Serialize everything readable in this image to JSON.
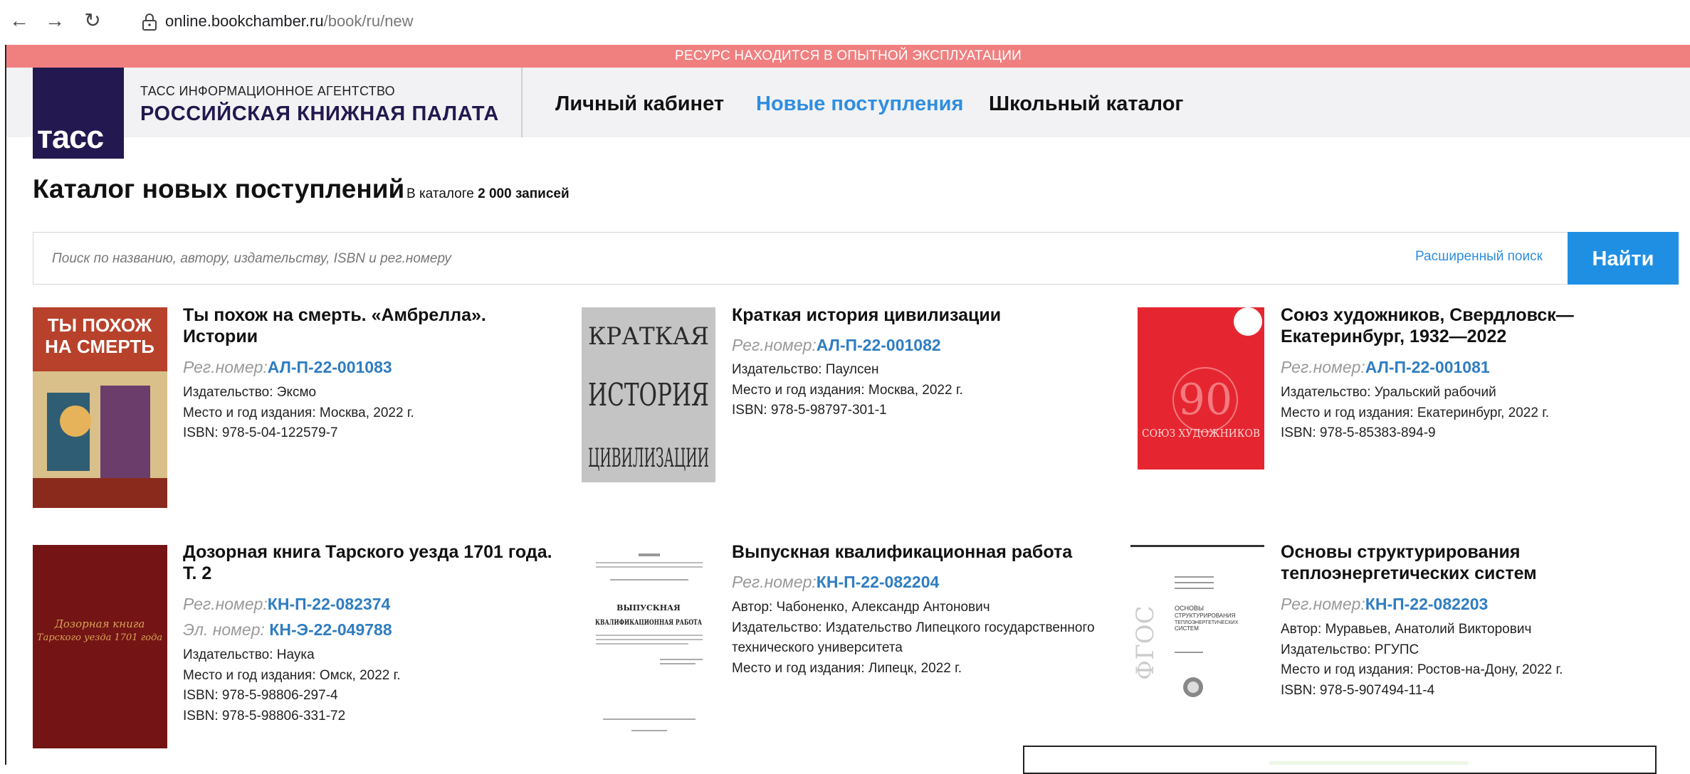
{
  "browser": {
    "url_host": "online.bookchamber.ru",
    "url_path": "/book/ru/new",
    "back_icon": "arrow-left",
    "forward_icon": "arrow-right",
    "reload_icon": "reload"
  },
  "banner": {
    "text": "РЕСУРС НАХОДИТСЯ В ОПЫТНОЙ ЭКСПЛУАТАЦИИ",
    "color": "#f08080"
  },
  "header": {
    "logo_text": "тасс",
    "org_line1": "ТАСС ИНФОРМАЦИОННОЕ АГЕНТСТВО",
    "org_line2": "РОССИЙСКАЯ КНИЖНАЯ ПАЛАТА",
    "menu": [
      {
        "label": "Личный кабинет",
        "active": false
      },
      {
        "label": "Новые поступления",
        "active": true
      },
      {
        "label": "Школьный каталог",
        "active": false
      }
    ]
  },
  "catalog": {
    "title": "Каталог новых поступлений",
    "count_prefix": "В каталоге",
    "count_value": "2 000 записей"
  },
  "search": {
    "placeholder": "Поиск по названию, автору, издательству, ISBN и рег.номеру",
    "value": "",
    "advanced_label": "Расширенный поиск",
    "submit_label": "Найти"
  },
  "labels": {
    "reg": "Рег.номер:",
    "el": "Эл. номер:"
  },
  "books": [
    {
      "title_line1": "Ты похож на смерть. «Амбрелла».",
      "title_line2": "Истории",
      "reg": "АЛ-П-22-001083",
      "meta": [
        "Издательство: Эксмо",
        "Место и год издания: Москва, 2022 г.",
        "ISBN:  978-5-04-122579-7"
      ],
      "cover_text": [
        "ТЫ ПОХОЖ",
        "НА СМЕРТЬ"
      ]
    },
    {
      "title_line1": "Краткая история цивилизации",
      "title_line2": "",
      "reg": "АЛ-П-22-001082",
      "meta": [
        "Издательство: Паулсен",
        "Место и год издания: Москва, 2022 г.",
        "ISBN:  978-5-98797-301-1"
      ],
      "cover_text": [
        "КРАТКАЯ",
        "ИСТОРИЯ",
        "ЦИВИЛИЗАЦИИ"
      ]
    },
    {
      "title_line1": "Союз художников, Свердловск—",
      "title_line2": "Екатеринбург, 1932—2022",
      "reg": "АЛ-П-22-001081",
      "meta": [
        "Издательство: Уральский рабочий",
        "Место и год издания: Екатеринбург, 2022 г.",
        "ISBN:  978-5-85383-894-9"
      ],
      "cover_text": [
        "90",
        "СОЮЗ ХУДОЖНИКОВ"
      ]
    },
    {
      "title_line1": "Дозорная книга Тарского уезда 1701 года.",
      "title_line2": "Т. 2",
      "reg": "КН-П-22-082374",
      "el": "КН-Э-22-049788",
      "meta": [
        "Издательство: Наука",
        "Место и год издания: Омск, 2022 г.",
        "ISBN:  978-5-98806-297-4",
        "ISBN:  978-5-98806-331-72"
      ],
      "cover_text": [
        "Дозорная книга",
        "Тарского уезда 1701 года"
      ]
    },
    {
      "title_line1": "Выпускная квалификационная работа",
      "title_line2": "",
      "reg": "КН-П-22-082204",
      "meta": [
        "Автор: Чабоненко, Александр Антонович",
        "Издательство: Издательство Липецкого государственного",
        "технического университета",
        "Место и год издания: Липецк, 2022 г."
      ],
      "cover_text": [
        "ВЫПУСКНАЯ",
        "КВАЛИФИКАЦИОННАЯ РАБОТА"
      ]
    },
    {
      "title_line1": "Основы структурирования",
      "title_line2": "теплоэнергетических систем",
      "reg": "КН-П-22-082203",
      "meta": [
        "Автор: Муравьев, Анатолий Викторович",
        "Издательство: РГУПС",
        "Место и год издания: Ростов-на-Дону, 2022 г.",
        "ISBN:  978-5-907494-11-4"
      ],
      "cover_text": [
        "ОСНОВЫ",
        "СТРУКТУРИРОВАНИЯ",
        "ТЕПЛОЭНЕРГЕТИЧЕСКИХ",
        "СИСТЕМ",
        "ФГОС"
      ]
    }
  ]
}
